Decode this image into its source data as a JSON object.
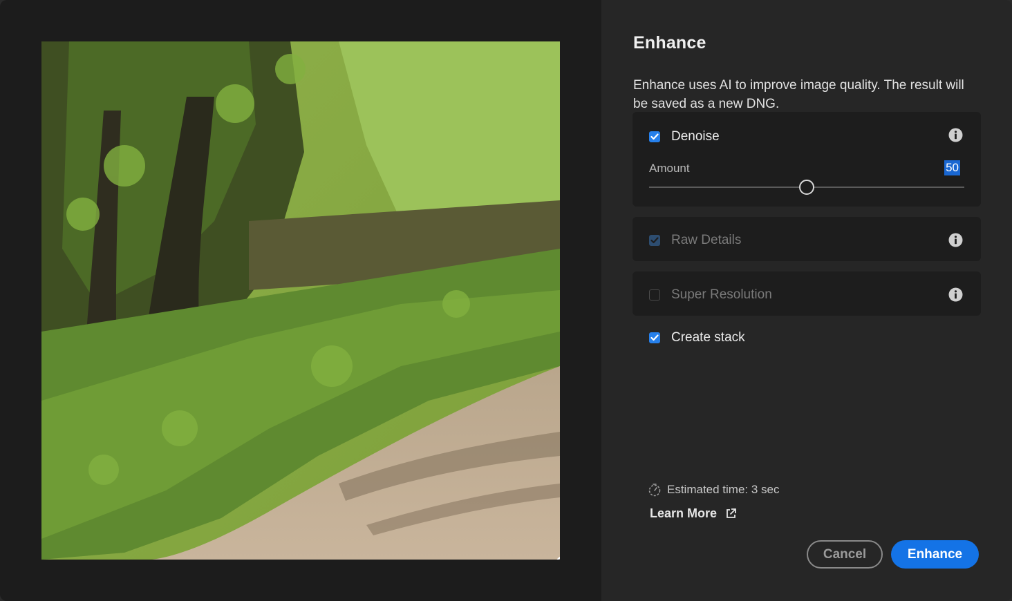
{
  "dialog": {
    "title": "Enhance",
    "description": "Enhance uses AI to improve image quality. The result will be saved as a new DNG."
  },
  "preview": {
    "zoom_icon": "zoom-out-icon"
  },
  "denoise": {
    "label": "Denoise",
    "checked": true,
    "info_icon": "info-icon",
    "amount_label": "Amount",
    "amount_value": "50",
    "amount_min": 0,
    "amount_max": 100
  },
  "raw_details": {
    "label": "Raw Details",
    "checked": true,
    "disabled": true,
    "info_icon": "info-icon"
  },
  "super_resolution": {
    "label": "Super Resolution",
    "checked": false,
    "disabled": true,
    "info_icon": "info-icon"
  },
  "create_stack": {
    "label": "Create stack",
    "checked": true
  },
  "footer": {
    "estimate_icon": "timer-icon",
    "estimate": "Estimated time: 3 sec",
    "learn_more": "Learn More",
    "learn_more_icon": "external-link-icon",
    "cancel_label": "Cancel",
    "enhance_label": "Enhance"
  },
  "colors": {
    "accent": "#1473e6",
    "checkbox": "#2680eb",
    "panel_bg": "#262626",
    "card_bg": "#1d1d1d"
  }
}
